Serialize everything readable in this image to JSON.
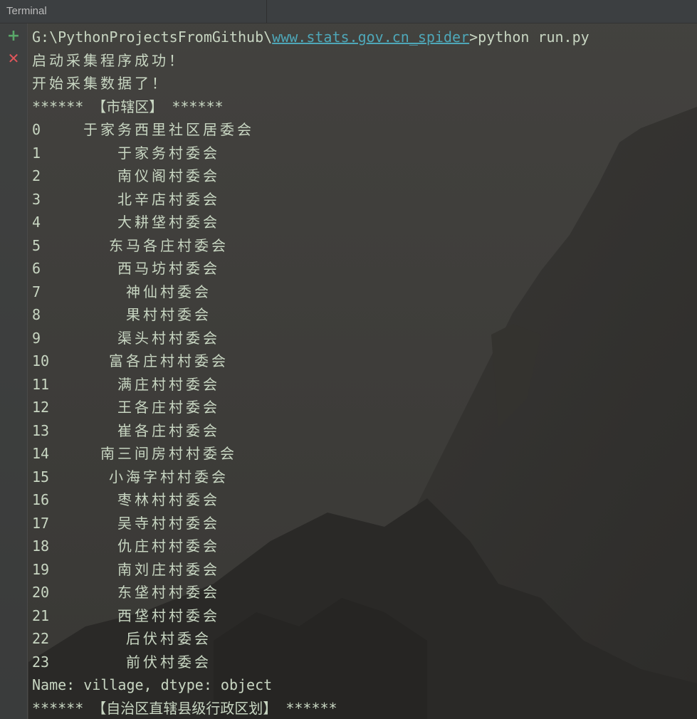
{
  "window": {
    "title": "Terminal"
  },
  "gutter": {
    "add_icon": "plus-icon",
    "close_icon": "close-icon"
  },
  "colors": {
    "add_green": "#59a869",
    "close_red": "#e0565b",
    "console_text": "#c8d6c2",
    "link": "#4ea7b8"
  },
  "prompt": {
    "path_prefix": "G:\\PythonProjectsFromGithub\\",
    "path_link": "www.stats.gov.cn_spider",
    "command": ">python run.py"
  },
  "messages": {
    "start_success": "启动采集程序成功！",
    "start_collect": "开始采集数据了！",
    "section_1": "****** 【市辖区】 ******",
    "dtype_line": "Name: village, dtype: object",
    "section_2": "****** 【自治区直辖县级行政区划】 ******"
  },
  "rows": [
    {
      "index": "0",
      "name": "于家务西里社区居委会"
    },
    {
      "index": "1",
      "name": "于家务村委会"
    },
    {
      "index": "2",
      "name": "南仪阁村委会"
    },
    {
      "index": "3",
      "name": "北辛店村委会"
    },
    {
      "index": "4",
      "name": "大耕垡村委会"
    },
    {
      "index": "5",
      "name": "东马各庄村委会"
    },
    {
      "index": "6",
      "name": "西马坊村委会"
    },
    {
      "index": "7",
      "name": "神仙村委会"
    },
    {
      "index": "8",
      "name": "果村村委会"
    },
    {
      "index": "9",
      "name": "渠头村村委会"
    },
    {
      "index": "10",
      "name": "富各庄村村委会"
    },
    {
      "index": "11",
      "name": "满庄村村委会"
    },
    {
      "index": "12",
      "name": "王各庄村委会"
    },
    {
      "index": "13",
      "name": "崔各庄村委会"
    },
    {
      "index": "14",
      "name": "南三间房村村委会"
    },
    {
      "index": "15",
      "name": "小海字村村委会"
    },
    {
      "index": "16",
      "name": "枣林村村委会"
    },
    {
      "index": "17",
      "name": "吴寺村村委会"
    },
    {
      "index": "18",
      "name": "仇庄村村委会"
    },
    {
      "index": "19",
      "name": "南刘庄村委会"
    },
    {
      "index": "20",
      "name": "东垡村村委会"
    },
    {
      "index": "21",
      "name": "西垡村村委会"
    },
    {
      "index": "22",
      "name": "后伏村委会"
    },
    {
      "index": "23",
      "name": "前伏村委会"
    }
  ]
}
